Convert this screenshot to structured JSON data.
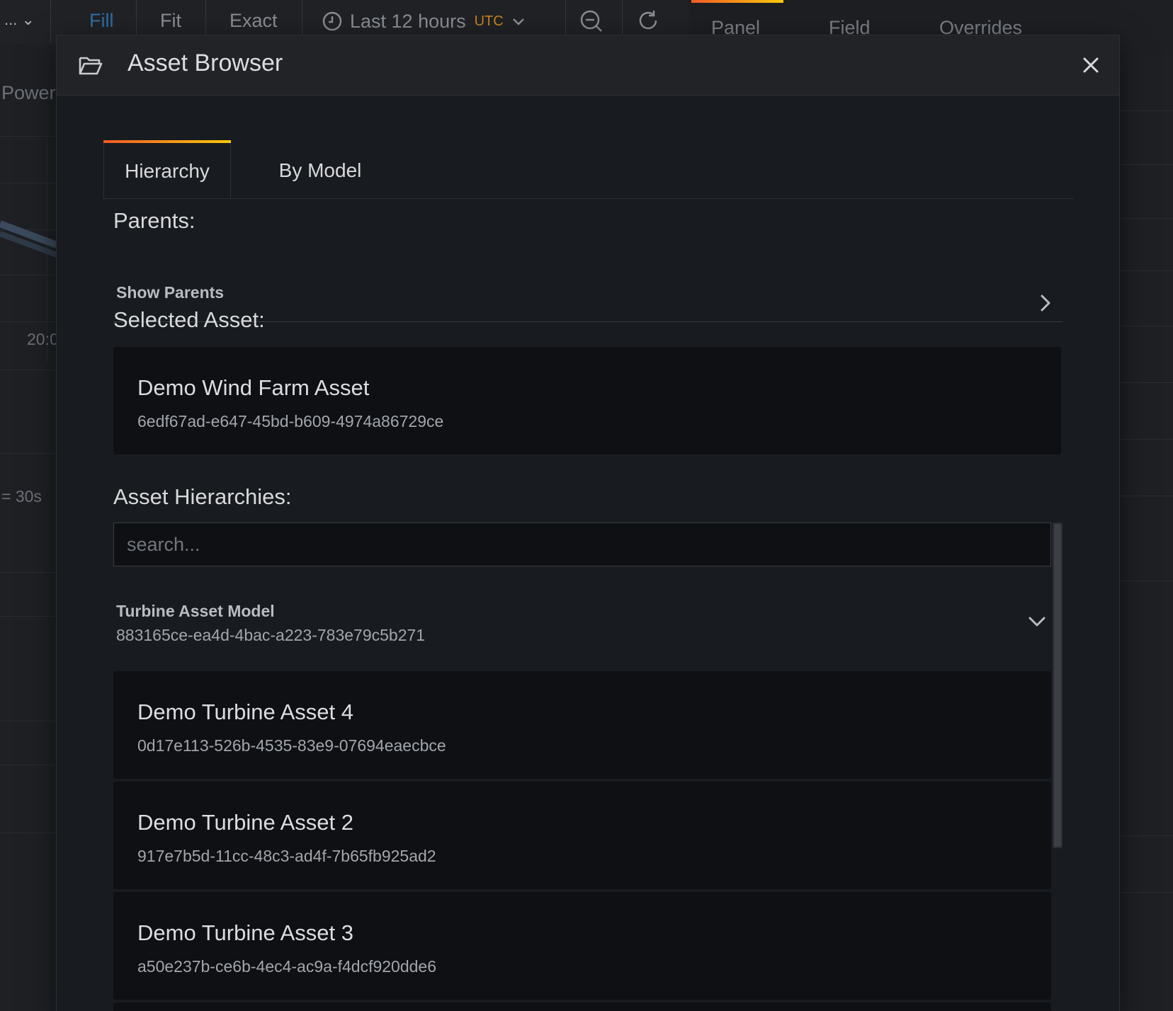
{
  "background": {
    "dropdown_label": "...",
    "toolbar": {
      "fill": "Fill",
      "fit": "Fit",
      "exact": "Exact"
    },
    "time_picker": {
      "label": "Last 12 hours",
      "tz": "UTC"
    },
    "editor_tabs": [
      "Panel",
      "Field",
      "Overrides"
    ],
    "panel_title": "Power",
    "axis_tick": "20:0",
    "interval_label": "= 30s"
  },
  "modal": {
    "title": "Asset Browser",
    "tabs": [
      {
        "label": "Hierarchy",
        "active": true
      },
      {
        "label": "By Model",
        "active": false
      }
    ],
    "parents": {
      "heading": "Parents:",
      "link": "Show Parents"
    },
    "selected": {
      "heading": "Selected Asset:",
      "name": "Demo Wind Farm Asset",
      "id": "6edf67ad-e647-45bd-b609-4974a86729ce"
    },
    "hierarchies": {
      "heading": "Asset Hierarchies:",
      "search_placeholder": "search...",
      "model": {
        "name": "Turbine Asset Model",
        "id": "883165ce-ea4d-4bac-a223-783e79c5b271"
      },
      "assets": [
        {
          "name": "Demo Turbine Asset 4",
          "id": "0d17e113-526b-4535-83e9-07694eaecbce"
        },
        {
          "name": "Demo Turbine Asset 2",
          "id": "917e7b5d-11cc-48c3-ad4f-7b65fb925ad2"
        },
        {
          "name": "Demo Turbine Asset 3",
          "id": "a50e237b-ce6b-4ec4-ac9a-f4dcf920dde6"
        }
      ]
    }
  },
  "colors": {
    "accent_start": "#f05a28",
    "accent_end": "#fbca0a",
    "utc": "#c8831f"
  }
}
